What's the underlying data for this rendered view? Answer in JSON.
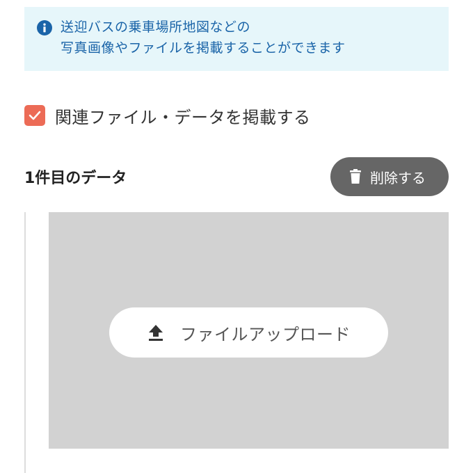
{
  "info": {
    "line1": "送迎バスの乗車場所地図などの",
    "line2": "写真画像やファイルを掲載することができます",
    "icon": "info-icon"
  },
  "checkbox": {
    "label": "関連ファイル・データを掲載する",
    "checked": true,
    "color": "#ec6b56"
  },
  "data_item": {
    "title": "1件目のデータ",
    "delete_label": "削除する"
  },
  "upload": {
    "button_label": "ファイルアップロード"
  },
  "colors": {
    "accent": "#1a64a8",
    "banner_bg": "#e6f6fa",
    "delete_bg": "#666666",
    "upload_bg": "#d2d2d2"
  }
}
